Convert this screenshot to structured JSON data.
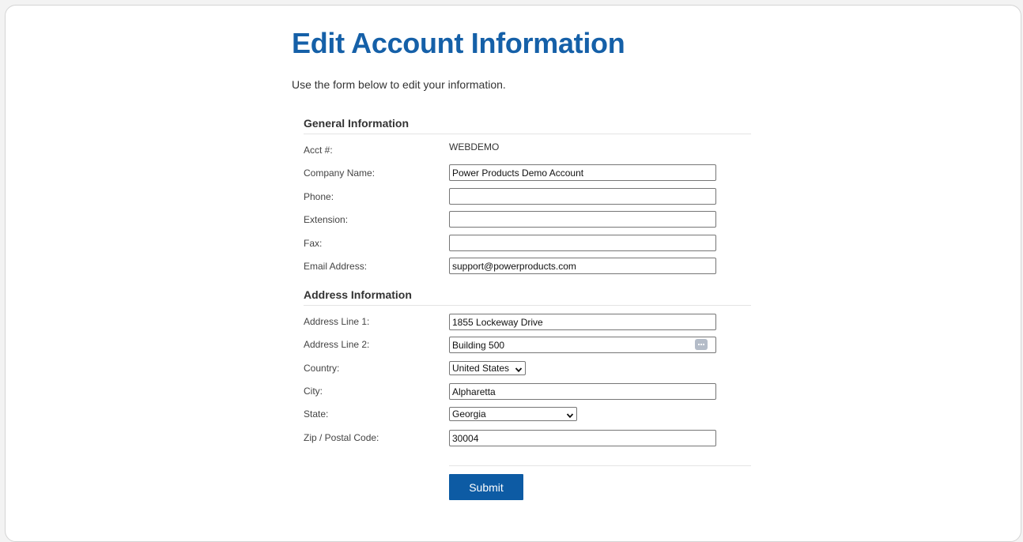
{
  "page": {
    "title": "Edit Account Information",
    "intro": "Use the form below to edit your information."
  },
  "general": {
    "heading": "General Information",
    "acct_label": "Acct #:",
    "acct_value": "WEBDEMO",
    "company_label": "Company Name:",
    "company_value": "Power Products Demo Account",
    "phone_label": "Phone:",
    "phone_value": "",
    "extension_label": "Extension:",
    "extension_value": "",
    "fax_label": "Fax:",
    "fax_value": "",
    "email_label": "Email Address:",
    "email_value": "support@powerproducts.com"
  },
  "address": {
    "heading": "Address Information",
    "line1_label": "Address Line 1:",
    "line1_value": "1855 Lockeway Drive",
    "line2_label": "Address Line 2:",
    "line2_value": "Building 500",
    "country_label": "Country:",
    "country_value": "United States",
    "city_label": "City:",
    "city_value": "Alpharetta",
    "state_label": "State:",
    "state_value": "Georgia",
    "zip_label": "Zip / Postal Code:",
    "zip_value": "30004"
  },
  "actions": {
    "submit_label": "Submit"
  },
  "colors": {
    "title": "#1560a8",
    "button": "#0d5ba4"
  },
  "icons": {
    "autofill": "autofill-icon",
    "dropdown": "chevron-down-icon"
  }
}
